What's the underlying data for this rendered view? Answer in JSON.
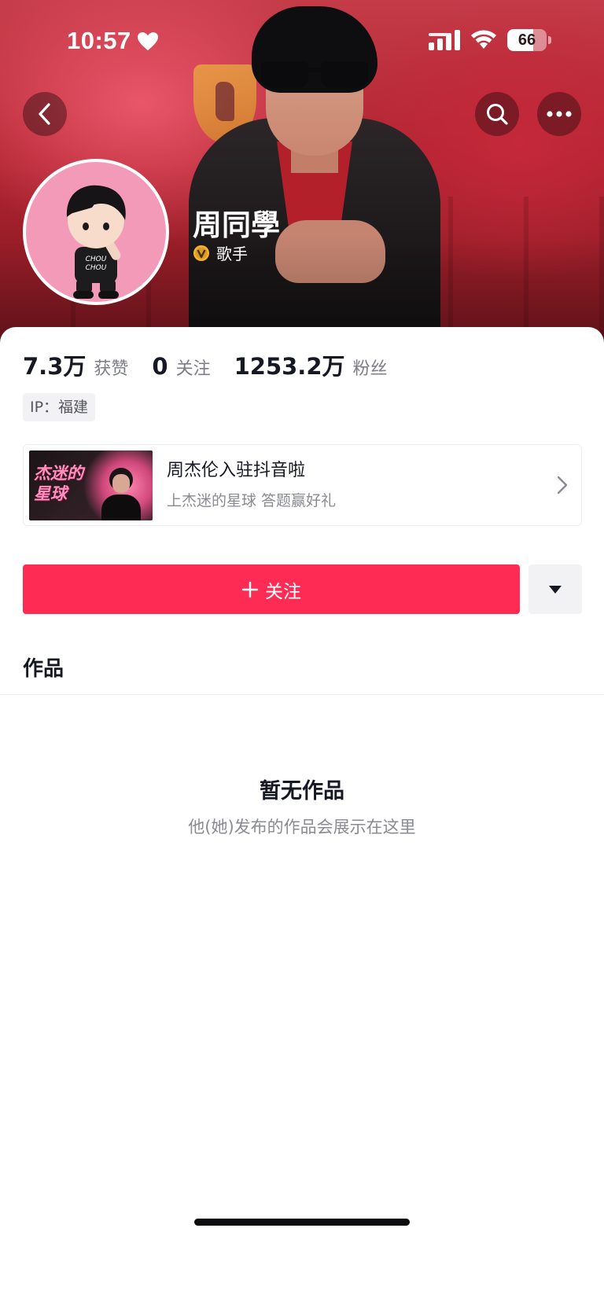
{
  "status_bar": {
    "time": "10:57",
    "battery_level": "66",
    "icons": [
      "heart-icon",
      "signal-icon",
      "wifi-icon",
      "battery-icon"
    ]
  },
  "nav": {
    "icons": [
      "chevron-left-icon",
      "search-icon",
      "more-icon"
    ]
  },
  "profile": {
    "nickname": "周同學",
    "verify_label": "歌手",
    "verify_icon": "verified-v-icon",
    "brand_color": "#fe2c55"
  },
  "stats": [
    {
      "value": "7.3万",
      "label": "获赞"
    },
    {
      "value": "0",
      "label": "关注"
    },
    {
      "value": "1253.2万",
      "label": "粉丝"
    }
  ],
  "ip_tag": "IP：福建",
  "promo": {
    "thumb_title": "杰迷的星球",
    "title": "周杰伦入驻抖音啦",
    "subtitle": "上杰迷的星球 答题赢好礼"
  },
  "actions": {
    "follow_label": "关注"
  },
  "tabs": {
    "works_label": "作品"
  },
  "empty_state": {
    "title": "暂无作品",
    "subtitle": "他(她)发布的作品会展示在这里"
  }
}
